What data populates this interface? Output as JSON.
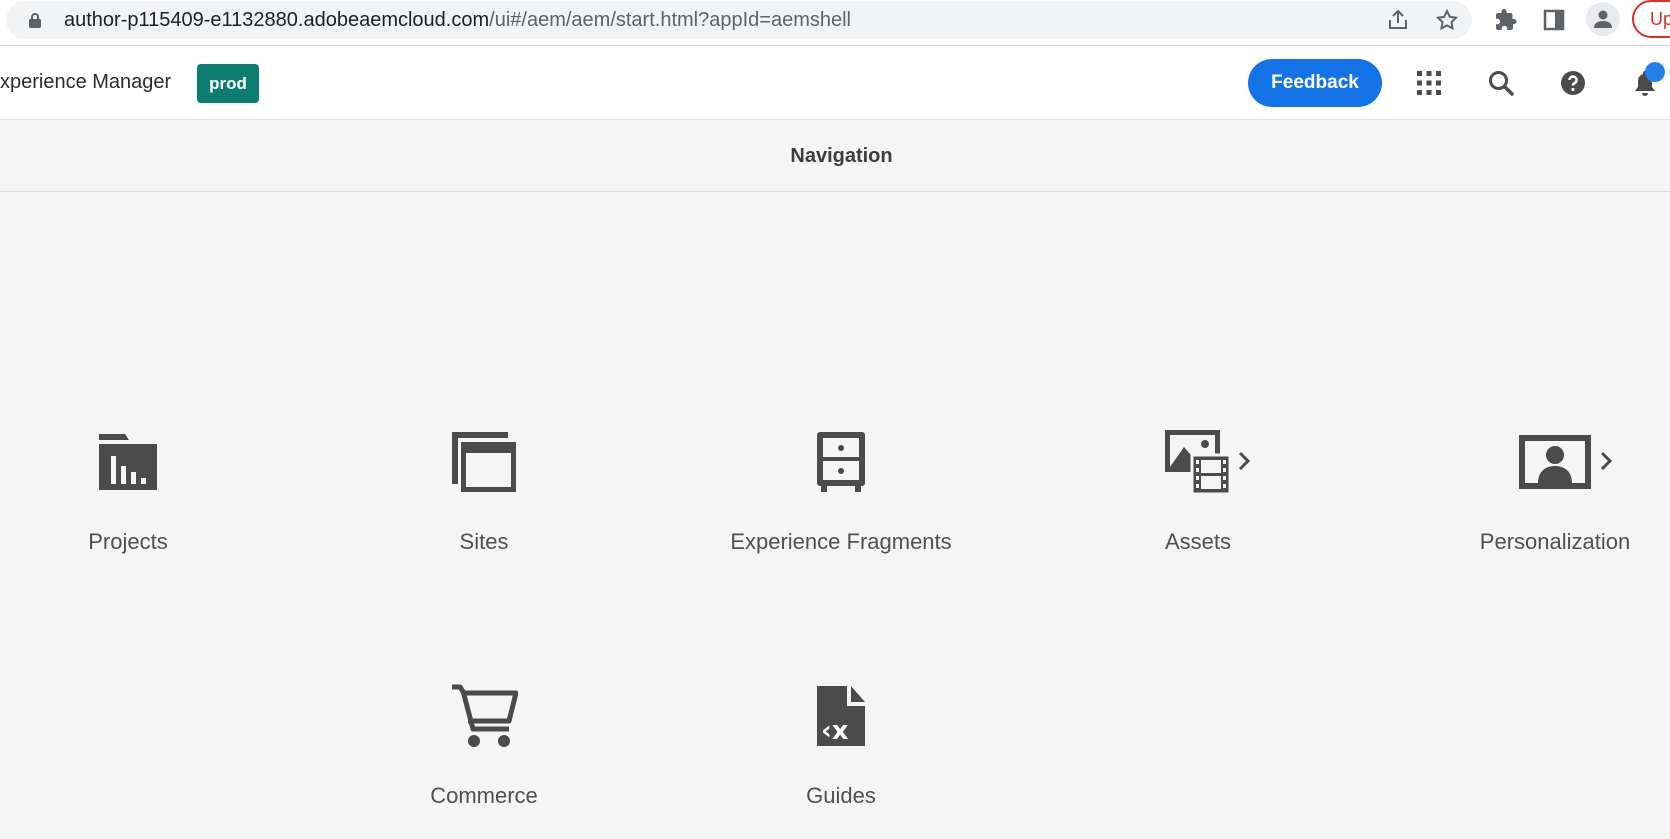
{
  "browser": {
    "url_host": "author-p115409-e1132880.adobeaemcloud.com",
    "url_path": "/ui#/aem/aem/start.html?appId=aemshell",
    "update_label": "Update"
  },
  "header": {
    "app_title": "xperience Manager",
    "env_badge": "prod",
    "feedback_label": "Feedback"
  },
  "nav": {
    "title": "Navigation"
  },
  "tiles": [
    {
      "label": "Projects",
      "icon": "projects-icon",
      "has_submenu": false
    },
    {
      "label": "Sites",
      "icon": "sites-icon",
      "has_submenu": false
    },
    {
      "label": "Experience Fragments",
      "icon": "experience-fragments-icon",
      "has_submenu": false
    },
    {
      "label": "Assets",
      "icon": "assets-icon",
      "has_submenu": true
    },
    {
      "label": "Personalization",
      "icon": "personalization-icon",
      "has_submenu": true
    },
    {
      "label": "Commerce",
      "icon": "commerce-icon",
      "has_submenu": false
    },
    {
      "label": "Guides",
      "icon": "guides-icon",
      "has_submenu": false
    }
  ],
  "colors": {
    "accent": "#1473e6",
    "badge": "#0d7d72",
    "icon": "#4b4b4b",
    "notification": "#2680eb"
  }
}
